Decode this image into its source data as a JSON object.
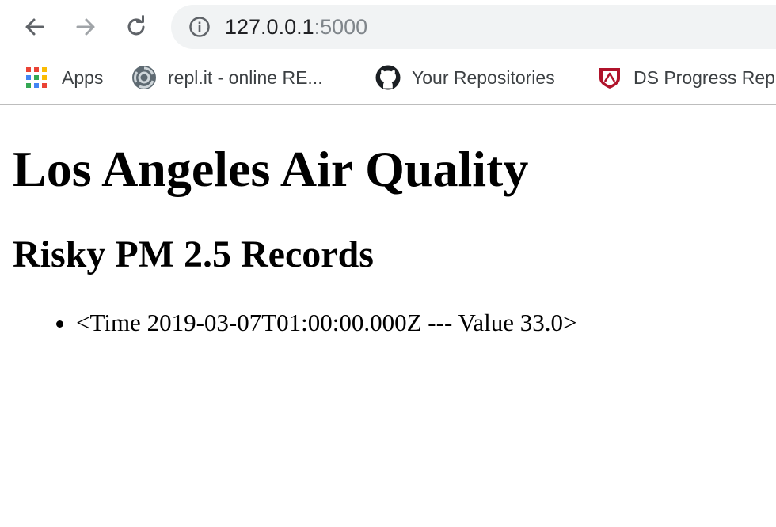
{
  "browser": {
    "url_host": "127.0.0.1",
    "url_port": ":5000",
    "icons": {
      "back": "arrow-left-icon",
      "forward": "arrow-right-icon",
      "reload": "reload-icon",
      "site_info": "info-icon"
    },
    "bookmarks": [
      {
        "label": "Apps",
        "icon": "apps-grid-icon"
      },
      {
        "label": "repl.it - online RE...",
        "icon": "replit-icon"
      },
      {
        "label": "Your Repositories",
        "icon": "github-icon"
      },
      {
        "label": "DS Progress Rep",
        "icon": "shield-icon"
      }
    ]
  },
  "page": {
    "title": "Los Angeles Air Quality",
    "subtitle": "Risky PM 2.5 Records",
    "records": [
      "<Time 2019-03-07T01:00:00.000Z --- Value 33.0>"
    ]
  },
  "colors": {
    "bookmark_text": "#3c4043",
    "omnibox_bg": "#f1f3f4",
    "port_text": "#80868b",
    "ds_shield": "#b0132b"
  }
}
